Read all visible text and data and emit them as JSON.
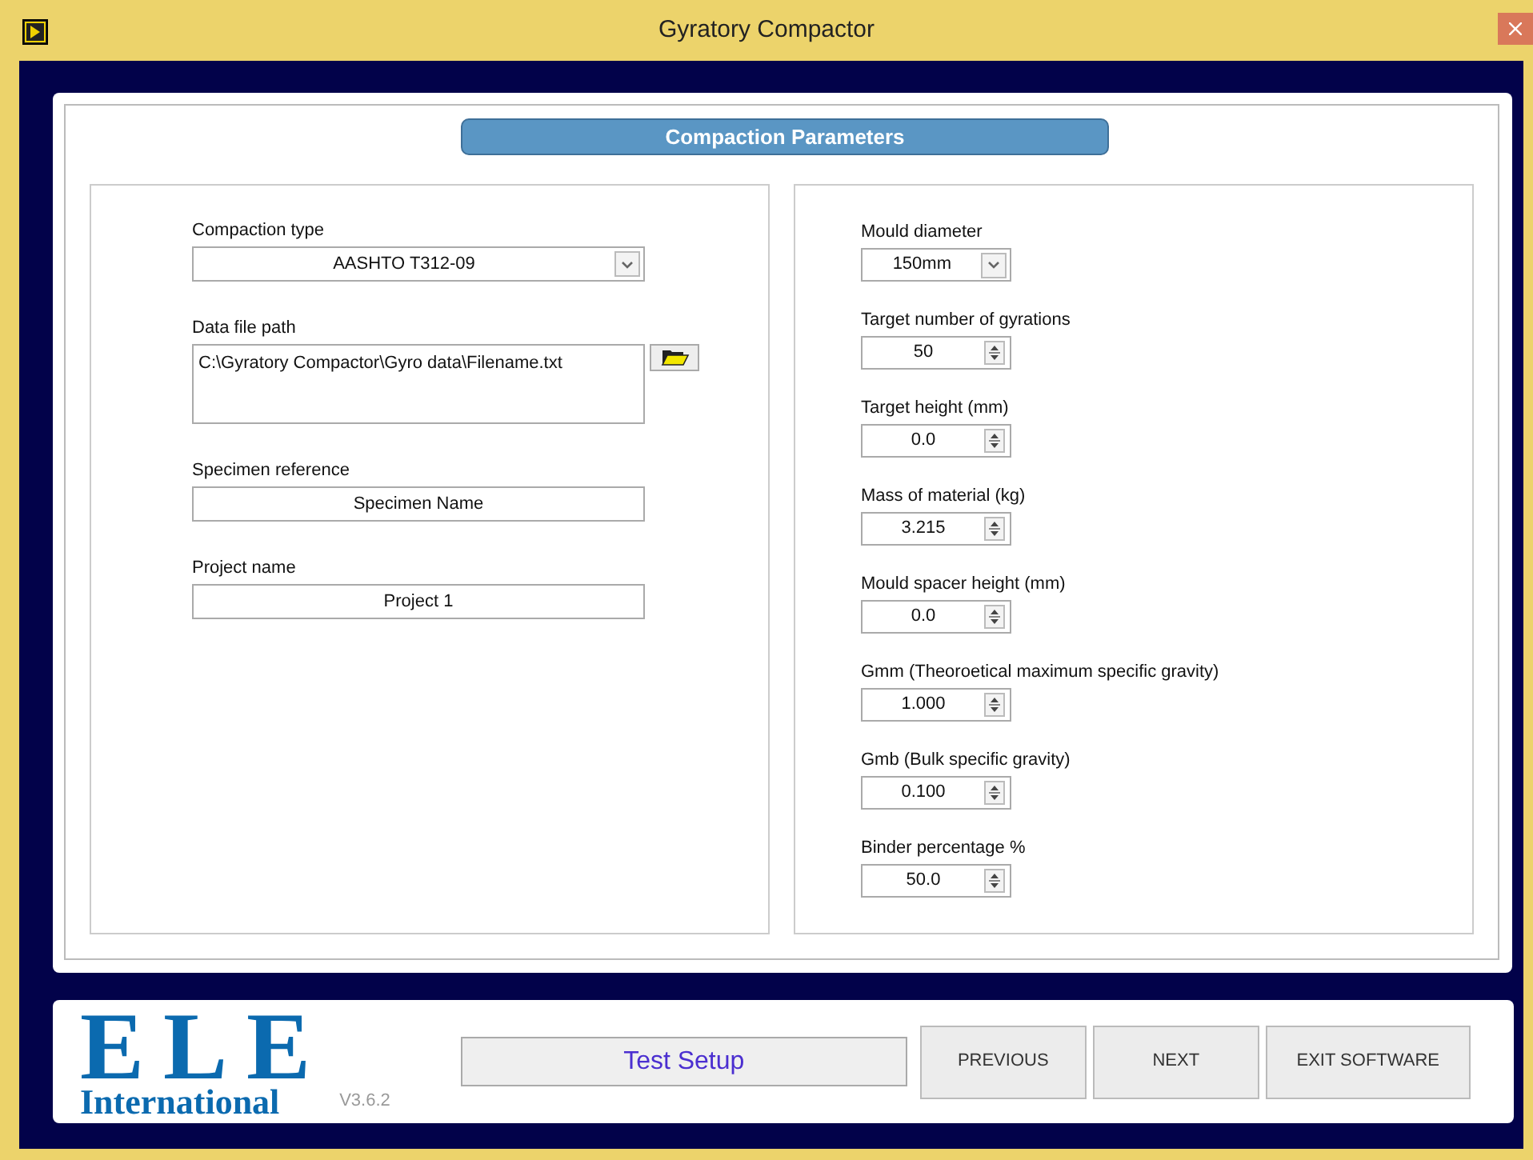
{
  "window": {
    "title": "Gyratory Compactor"
  },
  "header": "Compaction Parameters",
  "left_fields": [
    {
      "kind": "dropdown",
      "label": "Compaction type",
      "value": "AASHTO T312-09"
    },
    {
      "kind": "path",
      "label": "Data file path",
      "value": "C:\\Gyratory Compactor\\Gyro data\\Filename.txt"
    },
    {
      "kind": "text",
      "label": "Specimen reference",
      "value": "Specimen Name"
    },
    {
      "kind": "text",
      "label": "Project name",
      "value": "Project 1"
    }
  ],
  "right_fields": [
    {
      "kind": "dropdown",
      "label": "Mould diameter",
      "value": "150mm"
    },
    {
      "kind": "spinner",
      "label": "Target number of gyrations",
      "value": "50"
    },
    {
      "kind": "spinner",
      "label": "Target height (mm)",
      "value": "0.0"
    },
    {
      "kind": "spinner",
      "label": "Mass of material (kg)",
      "value": "3.215"
    },
    {
      "kind": "spinner",
      "label": "Mould spacer height (mm)",
      "value": "0.0"
    },
    {
      "kind": "spinner",
      "label": "Gmm (Theoroetical maximum specific gravity)",
      "value": "1.000"
    },
    {
      "kind": "spinner",
      "label": "Gmb (Bulk specific gravity)",
      "value": "0.100"
    },
    {
      "kind": "spinner",
      "label": "Binder percentage %",
      "value": "50.0"
    }
  ],
  "footer": {
    "logo_top": "ELE",
    "logo_bottom": "International",
    "version": "V3.6.2",
    "stage": "Test Setup",
    "buttons": [
      "PREVIOUS",
      "NEXT",
      "EXIT SOFTWARE"
    ]
  }
}
